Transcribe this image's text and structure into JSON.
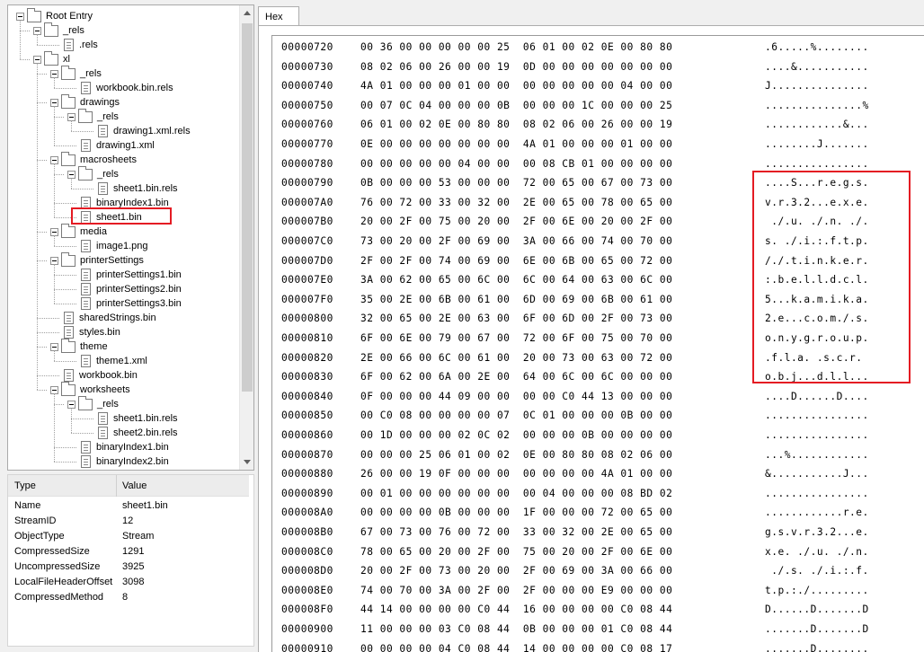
{
  "tree": {
    "nodes": [
      {
        "label": "Root Entry",
        "type": "folder"
      },
      {
        "label": "_rels",
        "type": "folder"
      },
      {
        "label": ".rels",
        "type": "file"
      },
      {
        "label": "xl",
        "type": "folder"
      },
      {
        "label": "_rels",
        "type": "folder"
      },
      {
        "label": "workbook.bin.rels",
        "type": "file"
      },
      {
        "label": "drawings",
        "type": "folder"
      },
      {
        "label": "_rels",
        "type": "folder"
      },
      {
        "label": "drawing1.xml.rels",
        "type": "file"
      },
      {
        "label": "drawing1.xml",
        "type": "file"
      },
      {
        "label": "macrosheets",
        "type": "folder"
      },
      {
        "label": "_rels",
        "type": "folder"
      },
      {
        "label": "sheet1.bin.rels",
        "type": "file"
      },
      {
        "label": "binaryIndex1.bin",
        "type": "file"
      },
      {
        "label": "sheet1.bin",
        "type": "file"
      },
      {
        "label": "media",
        "type": "folder"
      },
      {
        "label": "image1.png",
        "type": "file"
      },
      {
        "label": "printerSettings",
        "type": "folder"
      },
      {
        "label": "printerSettings1.bin",
        "type": "file"
      },
      {
        "label": "printerSettings2.bin",
        "type": "file"
      },
      {
        "label": "printerSettings3.bin",
        "type": "file"
      },
      {
        "label": "sharedStrings.bin",
        "type": "file"
      },
      {
        "label": "styles.bin",
        "type": "file"
      },
      {
        "label": "theme",
        "type": "folder"
      },
      {
        "label": "theme1.xml",
        "type": "file"
      },
      {
        "label": "workbook.bin",
        "type": "file"
      },
      {
        "label": "worksheets",
        "type": "folder"
      },
      {
        "label": "_rels",
        "type": "folder"
      },
      {
        "label": "sheet1.bin.rels",
        "type": "file"
      },
      {
        "label": "sheet2.bin.rels",
        "type": "file"
      },
      {
        "label": "binaryIndex1.bin",
        "type": "file"
      },
      {
        "label": "binaryIndex2.bin",
        "type": "file"
      }
    ],
    "selected_label": "sheet1.bin",
    "highlight_color": "#e41b23"
  },
  "props": {
    "header": {
      "type": "Type",
      "value": "Value"
    },
    "rows": [
      {
        "name": "Name",
        "value": "sheet1.bin"
      },
      {
        "name": "StreamID",
        "value": "12"
      },
      {
        "name": "ObjectType",
        "value": "Stream"
      },
      {
        "name": "CompressedSize",
        "value": "1291"
      },
      {
        "name": "UncompressedSize",
        "value": "3925"
      },
      {
        "name": "LocalFileHeaderOffset",
        "value": "3098"
      },
      {
        "name": "CompressedMethod",
        "value": "8"
      }
    ]
  },
  "hex": {
    "tab_label": "Hex",
    "rows": [
      {
        "offset": "00000720",
        "bytes": "00 36 00 00 00 00 00 25  06 01 00 02 0E 00 80 80",
        "ascii": ".6.....%........"
      },
      {
        "offset": "00000730",
        "bytes": "08 02 06 00 26 00 00 19  0D 00 00 00 00 00 00 00",
        "ascii": "....&..........."
      },
      {
        "offset": "00000740",
        "bytes": "4A 01 00 00 00 01 00 00  00 00 00 00 00 04 00 00",
        "ascii": "J..............."
      },
      {
        "offset": "00000750",
        "bytes": "00 07 0C 04 00 00 00 0B  00 00 00 1C 00 00 00 25",
        "ascii": "...............%"
      },
      {
        "offset": "00000760",
        "bytes": "06 01 00 02 0E 00 80 80  08 02 06 00 26 00 00 19",
        "ascii": "............&..."
      },
      {
        "offset": "00000770",
        "bytes": "0E 00 00 00 00 00 00 00  4A 01 00 00 00 01 00 00",
        "ascii": "........J......."
      },
      {
        "offset": "00000780",
        "bytes": "00 00 00 00 00 04 00 00  00 08 CB 01 00 00 00 00",
        "ascii": "................"
      },
      {
        "offset": "00000790",
        "bytes": "0B 00 00 00 53 00 00 00  72 00 65 00 67 00 73 00",
        "ascii": "....S...r.e.g.s."
      },
      {
        "offset": "000007A0",
        "bytes": "76 00 72 00 33 00 32 00  2E 00 65 00 78 00 65 00",
        "ascii": "v.r.3.2...e.x.e."
      },
      {
        "offset": "000007B0",
        "bytes": "20 00 2F 00 75 00 20 00  2F 00 6E 00 20 00 2F 00",
        "ascii": " ./.u. ./.n. ./."
      },
      {
        "offset": "000007C0",
        "bytes": "73 00 20 00 2F 00 69 00  3A 00 66 00 74 00 70 00",
        "ascii": "s. ./.i.:.f.t.p."
      },
      {
        "offset": "000007D0",
        "bytes": "2F 00 2F 00 74 00 69 00  6E 00 6B 00 65 00 72 00",
        "ascii": "/./.t.i.n.k.e.r."
      },
      {
        "offset": "000007E0",
        "bytes": "3A 00 62 00 65 00 6C 00  6C 00 64 00 63 00 6C 00",
        "ascii": ":.b.e.l.l.d.c.l."
      },
      {
        "offset": "000007F0",
        "bytes": "35 00 2E 00 6B 00 61 00  6D 00 69 00 6B 00 61 00",
        "ascii": "5...k.a.m.i.k.a."
      },
      {
        "offset": "00000800",
        "bytes": "32 00 65 00 2E 00 63 00  6F 00 6D 00 2F 00 73 00",
        "ascii": "2.e...c.o.m./.s."
      },
      {
        "offset": "00000810",
        "bytes": "6F 00 6E 00 79 00 67 00  72 00 6F 00 75 00 70 00",
        "ascii": "o.n.y.g.r.o.u.p."
      },
      {
        "offset": "00000820",
        "bytes": "2E 00 66 00 6C 00 61 00  20 00 73 00 63 00 72 00",
        "ascii": ".f.l.a. .s.c.r."
      },
      {
        "offset": "00000830",
        "bytes": "6F 00 62 00 6A 00 2E 00  64 00 6C 00 6C 00 00 00",
        "ascii": "o.b.j...d.l.l..."
      },
      {
        "offset": "00000840",
        "bytes": "0F 00 00 00 44 09 00 00  00 00 C0 44 13 00 00 00",
        "ascii": "....D......D...."
      },
      {
        "offset": "00000850",
        "bytes": "00 C0 08 00 00 00 00 07  0C 01 00 00 00 0B 00 00",
        "ascii": "................"
      },
      {
        "offset": "00000860",
        "bytes": "00 1D 00 00 00 02 0C 02  00 00 00 0B 00 00 00 00",
        "ascii": "................"
      },
      {
        "offset": "00000870",
        "bytes": "00 00 00 25 06 01 00 02  0E 00 80 80 08 02 06 00",
        "ascii": "...%............"
      },
      {
        "offset": "00000880",
        "bytes": "26 00 00 19 0F 00 00 00  00 00 00 00 4A 01 00 00",
        "ascii": "&...........J..."
      },
      {
        "offset": "00000890",
        "bytes": "00 01 00 00 00 00 00 00  00 04 00 00 00 08 BD 02",
        "ascii": "................"
      },
      {
        "offset": "000008A0",
        "bytes": "00 00 00 00 0B 00 00 00  1F 00 00 00 72 00 65 00",
        "ascii": "............r.e."
      },
      {
        "offset": "000008B0",
        "bytes": "67 00 73 00 76 00 72 00  33 00 32 00 2E 00 65 00",
        "ascii": "g.s.v.r.3.2...e."
      },
      {
        "offset": "000008C0",
        "bytes": "78 00 65 00 20 00 2F 00  75 00 20 00 2F 00 6E 00",
        "ascii": "x.e. ./.u. ./.n."
      },
      {
        "offset": "000008D0",
        "bytes": "20 00 2F 00 73 00 20 00  2F 00 69 00 3A 00 66 00",
        "ascii": " ./.s. ./.i.:.f."
      },
      {
        "offset": "000008E0",
        "bytes": "74 00 70 00 3A 00 2F 00  2F 00 00 00 E9 00 00 00",
        "ascii": "t.p.:./........."
      },
      {
        "offset": "000008F0",
        "bytes": "44 14 00 00 00 00 C0 44  16 00 00 00 00 C0 08 44",
        "ascii": "D......D.......D"
      },
      {
        "offset": "00000900",
        "bytes": "11 00 00 00 03 C0 08 44  0B 00 00 00 01 C0 08 44",
        "ascii": ".......D.......D"
      },
      {
        "offset": "00000910",
        "bytes": "00 00 00 00 04 C0 08 44  14 00 00 00 00 C0 08 17",
        "ascii": ".......D........"
      }
    ]
  }
}
